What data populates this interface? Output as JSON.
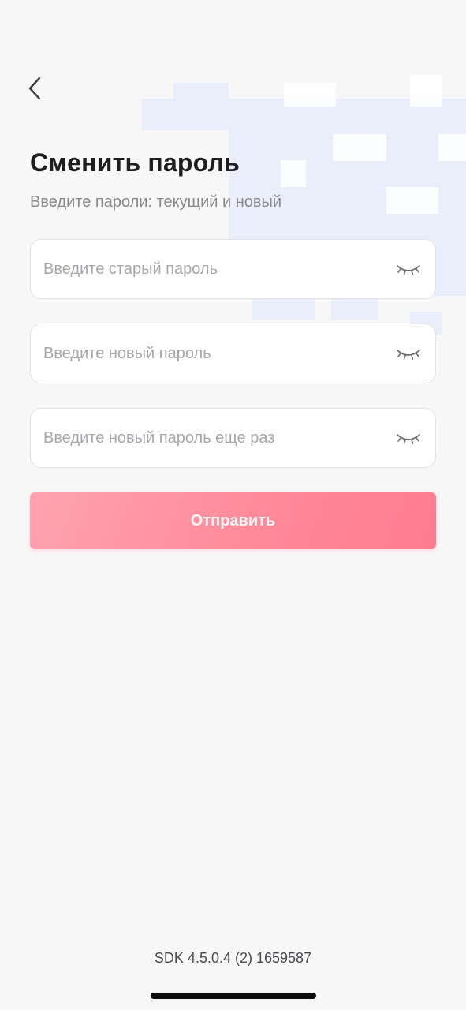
{
  "header": {
    "back_icon": "chevron-left-icon"
  },
  "page": {
    "title": "Сменить пароль",
    "subtitle": "Введите пароли: текущий и новый"
  },
  "fields": {
    "old_password": {
      "placeholder": "Введите старый пароль",
      "value": "",
      "toggle_icon": "eye-closed-icon"
    },
    "new_password": {
      "placeholder": "Введите новый пароль",
      "value": "",
      "toggle_icon": "eye-closed-icon"
    },
    "confirm_password": {
      "placeholder": "Введите новый пароль еще раз",
      "value": "",
      "toggle_icon": "eye-closed-icon"
    }
  },
  "submit": {
    "label": "Отправить"
  },
  "footer": {
    "sdk_version": "SDK 4.5.0.4 (2) 1659587"
  },
  "colors": {
    "background": "#f7f7f8",
    "accent": "#ff8898",
    "placeholder": "#a7a7ac",
    "title": "#1f1f1f"
  }
}
